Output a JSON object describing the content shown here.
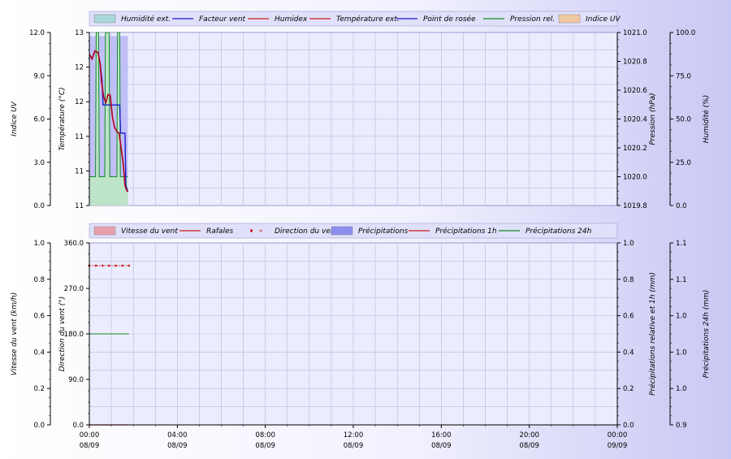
{
  "colors": {
    "bg_right": "#c8c8f4",
    "plot_bg": "#ececff",
    "grid": "#b8b8dd",
    "blue": "#1a1acc",
    "red": "#cc1a1a",
    "darkred": "#b00020",
    "green": "#138a2a",
    "pink_fill": "#e6a0aa",
    "blue_fill": "#8e8ef0",
    "cyan_fill": "#a8d8d8",
    "orange_fill": "#f0c8a0",
    "humid_fill": "#b8b8f4",
    "green_fill": "#bde8c4"
  },
  "chart_data": [
    {
      "type": "line",
      "legend": [
        {
          "name": "Humidité ext.",
          "style": "area",
          "color": "#a8d8d8"
        },
        {
          "name": "Facteur vent",
          "style": "line",
          "color": "#1a1acc"
        },
        {
          "name": "Humidex",
          "style": "line",
          "color": "#cc1a1a"
        },
        {
          "name": "Température ext.",
          "style": "line",
          "color": "#cc1a1a"
        },
        {
          "name": "Point de rosée",
          "style": "line",
          "color": "#1a1acc"
        },
        {
          "name": "Pression rel.",
          "style": "line",
          "color": "#138a2a"
        },
        {
          "name": "Indice UV",
          "style": "area",
          "color": "#f0c8a0"
        }
      ],
      "axes": {
        "uv": {
          "label": "Indice UV",
          "ticks": [
            "12.0",
            "9.0",
            "6.0",
            "3.0",
            "0.0"
          ],
          "range": [
            0,
            12
          ]
        },
        "temp": {
          "label": "Température (°C)",
          "ticks": [
            "13",
            "12",
            "12",
            "11",
            "11",
            "11"
          ],
          "range": [
            10.8,
            12.95
          ]
        },
        "pressure": {
          "label": "Pression (hPa)",
          "ticks": [
            "1021.0",
            "1020.8",
            "1020.6",
            "1020.4",
            "1020.2",
            "1020.0",
            "1019.8"
          ],
          "range": [
            1019.8,
            1021.0
          ]
        },
        "humidity": {
          "label": "Humidité (%)",
          "ticks": [
            "100.0",
            "75.0",
            "50.0",
            "25.0",
            "0.0"
          ],
          "range": [
            0,
            100
          ]
        }
      },
      "x_range_hours": [
        0,
        24
      ],
      "series": [
        {
          "name": "Humidité ext.",
          "axis": "humidity",
          "x": [
            0,
            1.75
          ],
          "y": [
            98,
            98
          ]
        },
        {
          "name": "Température ext.",
          "axis": "temp",
          "x": [
            0,
            0.12,
            0.25,
            0.4,
            0.5,
            0.55,
            0.65,
            0.75,
            0.85,
            0.95,
            1.05,
            1.15,
            1.25,
            1.35,
            1.45,
            1.55,
            1.62,
            1.7,
            1.75
          ],
          "y": [
            12.68,
            12.62,
            12.72,
            12.7,
            12.55,
            12.35,
            12.15,
            12.08,
            12.18,
            12.17,
            11.9,
            11.77,
            11.72,
            11.7,
            11.5,
            11.3,
            11.05,
            10.99,
            10.97
          ]
        },
        {
          "name": "Humidex",
          "axis": "temp",
          "x": [
            0,
            0.12,
            0.25,
            0.4,
            0.5,
            0.55,
            0.65,
            0.75,
            0.85,
            0.95,
            1.05,
            1.15,
            1.25,
            1.35,
            1.45,
            1.55,
            1.62,
            1.7,
            1.75
          ],
          "y": [
            12.68,
            12.62,
            12.72,
            12.7,
            12.55,
            12.35,
            12.15,
            12.08,
            12.18,
            12.17,
            11.9,
            11.77,
            11.72,
            11.7,
            11.5,
            11.3,
            11.05,
            10.99,
            10.97
          ]
        },
        {
          "name": "Facteur vent",
          "axis": "temp",
          "x": [
            0,
            0.12,
            0.25,
            0.4,
            0.5,
            0.58,
            0.62,
            1.38,
            1.42,
            1.62,
            1.66,
            1.75
          ],
          "y": [
            12.68,
            12.62,
            12.72,
            12.7,
            12.55,
            12.35,
            12.05,
            12.05,
            11.7,
            11.7,
            11.05,
            10.97
          ]
        },
        {
          "name": "Point de rosée",
          "axis": "temp",
          "x": [
            0,
            0.12,
            0.25,
            0.4,
            0.5,
            0.58,
            0.62,
            1.38,
            1.42,
            1.62,
            1.66,
            1.75
          ],
          "y": [
            12.68,
            12.62,
            12.72,
            12.7,
            12.55,
            12.35,
            12.05,
            12.05,
            11.7,
            11.7,
            11.05,
            10.97
          ]
        },
        {
          "name": "Pression rel.",
          "axis": "pressure",
          "x": [
            0,
            0.28,
            0.31,
            0.42,
            0.45,
            0.7,
            0.73,
            0.9,
            0.93,
            1.25,
            1.28,
            1.38,
            1.41,
            1.75
          ],
          "y": [
            1020.0,
            1020.0,
            1021.0,
            1021.0,
            1020.0,
            1020.0,
            1021.0,
            1021.0,
            1020.0,
            1020.0,
            1021.0,
            1021.0,
            1020.0,
            1020.0
          ]
        }
      ]
    },
    {
      "type": "line",
      "legend": [
        {
          "name": "Vitesse du vent",
          "style": "area",
          "color": "#e6a0aa"
        },
        {
          "name": "Rafales",
          "style": "line",
          "color": "#cc1a1a"
        },
        {
          "name": "Direction du vent",
          "style": "dots",
          "color": "#cc1a1a"
        },
        {
          "name": "Précipitations",
          "style": "area",
          "color": "#8e8ef0"
        },
        {
          "name": "Précipitations 1h",
          "style": "line",
          "color": "#cc1a1a"
        },
        {
          "name": "Précipitations 24h",
          "style": "line",
          "color": "#138a2a"
        }
      ],
      "axes": {
        "wind_speed": {
          "label": "Vitesse du vent (km/h)",
          "ticks": [
            "1.0",
            "0.8",
            "0.6",
            "0.4",
            "0.2",
            "0.0"
          ],
          "range": [
            0,
            1
          ]
        },
        "wind_dir": {
          "label": "Direction du vent (°)",
          "ticks": [
            "360.0",
            "270.0",
            "180.0",
            "90.0",
            "0.0"
          ],
          "range": [
            0,
            360
          ]
        },
        "rain_rel": {
          "label": "Précipitations relative et 1h (mm)",
          "ticks": [
            "1.0",
            "0.8",
            "0.6",
            "0.4",
            "0.2",
            "0.0"
          ],
          "range": [
            0,
            1
          ]
        },
        "rain_24h": {
          "label": "Précipitations 24h (mm)",
          "ticks": [
            "1.1",
            "1.1",
            "1.0",
            "1.0",
            "1.0",
            "0.9"
          ],
          "range": [
            0.9,
            1.1
          ]
        }
      },
      "x_range_hours": [
        0,
        24
      ],
      "x_ticks": [
        {
          "time": "00:00",
          "date": "08/09"
        },
        {
          "time": "04:00",
          "date": "08/09"
        },
        {
          "time": "08:00",
          "date": "08/09"
        },
        {
          "time": "12:00",
          "date": "08/09"
        },
        {
          "time": "16:00",
          "date": "08/09"
        },
        {
          "time": "20:00",
          "date": "08/09"
        },
        {
          "time": "00:00",
          "date": "09/09"
        }
      ],
      "series": [
        {
          "name": "Vitesse du vent",
          "axis": "wind_speed",
          "x": [
            0,
            1.75
          ],
          "y": [
            0,
            0
          ]
        },
        {
          "name": "Rafales",
          "axis": "wind_speed",
          "x": [
            0,
            1.75
          ],
          "y": [
            0,
            0
          ]
        },
        {
          "name": "Direction du vent",
          "axis": "wind_dir",
          "x": [
            0,
            0.3,
            0.6,
            0.9,
            1.2,
            1.5,
            1.8
          ],
          "y": [
            315,
            315,
            315,
            315,
            315,
            315,
            315
          ]
        },
        {
          "name": "Précipitations 24h",
          "axis": "rain_24h",
          "x": [
            0,
            1.8
          ],
          "y": [
            1.0,
            1.0
          ]
        }
      ]
    }
  ]
}
